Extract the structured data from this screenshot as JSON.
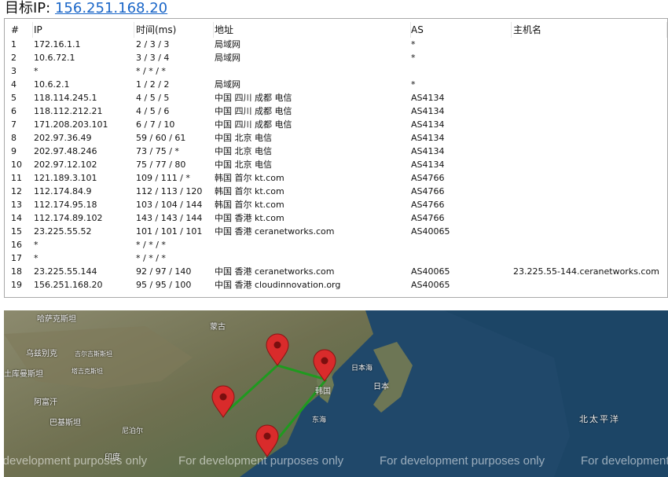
{
  "header": {
    "label": "目标IP:",
    "ip": "156.251.168.20"
  },
  "table": {
    "columns": [
      "#",
      "IP",
      "时间(ms)",
      "地址",
      "AS",
      "主机名"
    ],
    "rows": [
      {
        "n": "1",
        "ip": "172.16.1.1",
        "time": "2 / 3 / 3",
        "addr": "局域网",
        "as": "*",
        "host": ""
      },
      {
        "n": "2",
        "ip": "10.6.72.1",
        "time": "3 / 3 / 4",
        "addr": "局域网",
        "as": "*",
        "host": ""
      },
      {
        "n": "3",
        "ip": "*",
        "time": "* / * / *",
        "addr": "",
        "as": "",
        "host": ""
      },
      {
        "n": "4",
        "ip": "10.6.2.1",
        "time": "1 / 2 / 2",
        "addr": "局域网",
        "as": "*",
        "host": ""
      },
      {
        "n": "5",
        "ip": "118.114.245.1",
        "time": "4 / 5 / 5",
        "addr": "中国 四川 成都 电信",
        "as": "AS4134",
        "host": ""
      },
      {
        "n": "6",
        "ip": "118.112.212.21",
        "time": "4 / 5 / 6",
        "addr": "中国 四川 成都 电信",
        "as": "AS4134",
        "host": ""
      },
      {
        "n": "7",
        "ip": "171.208.203.101",
        "time": "6 / 7 / 10",
        "addr": "中国 四川 成都 电信",
        "as": "AS4134",
        "host": ""
      },
      {
        "n": "8",
        "ip": "202.97.36.49",
        "time": "59 / 60 / 61",
        "addr": "中国 北京 电信",
        "as": "AS4134",
        "host": ""
      },
      {
        "n": "9",
        "ip": "202.97.48.246",
        "time": "73 / 75 / *",
        "addr": "中国 北京 电信",
        "as": "AS4134",
        "host": ""
      },
      {
        "n": "10",
        "ip": "202.97.12.102",
        "time": "75 / 77 / 80",
        "addr": "中国 北京 电信",
        "as": "AS4134",
        "host": ""
      },
      {
        "n": "11",
        "ip": "121.189.3.101",
        "time": "109 / 111 / *",
        "addr": "韩国 首尔 kt.com",
        "as": "AS4766",
        "host": ""
      },
      {
        "n": "12",
        "ip": "112.174.84.9",
        "time": "112 / 113 / 120",
        "addr": "韩国 首尔 kt.com",
        "as": "AS4766",
        "host": ""
      },
      {
        "n": "13",
        "ip": "112.174.95.18",
        "time": "103 / 104 / 144",
        "addr": "韩国 首尔 kt.com",
        "as": "AS4766",
        "host": ""
      },
      {
        "n": "14",
        "ip": "112.174.89.102",
        "time": "143 / 143 / 144",
        "addr": "中国 香港 kt.com",
        "as": "AS4766",
        "host": ""
      },
      {
        "n": "15",
        "ip": "23.225.55.52",
        "time": "101 / 101 / 101",
        "addr": "中国 香港 ceranetworks.com",
        "as": "AS40065",
        "host": ""
      },
      {
        "n": "16",
        "ip": "*",
        "time": "* / * / *",
        "addr": "",
        "as": "",
        "host": ""
      },
      {
        "n": "17",
        "ip": "*",
        "time": "* / * / *",
        "addr": "",
        "as": "",
        "host": ""
      },
      {
        "n": "18",
        "ip": "23.225.55.144",
        "time": "92 / 97 / 140",
        "addr": "中国 香港 ceranetworks.com",
        "as": "AS40065",
        "host": "23.225.55-144.ceranetworks.com"
      },
      {
        "n": "19",
        "ip": "156.251.168.20",
        "time": "95 / 95 / 100",
        "addr": "中国 香港 cloudinnovation.org",
        "as": "AS40065",
        "host": ""
      }
    ]
  },
  "map": {
    "watermark": "For development purposes only",
    "labels": [
      "哈萨克斯坦",
      "蒙古",
      "乌兹别克",
      "吉尔吉斯斯坦",
      "塔吉克斯坦",
      "土库曼斯坦",
      "阿富汗",
      "巴基斯坦",
      "尼泊尔",
      "印度",
      "日本海",
      "日本",
      "韩国",
      "东海",
      "北太平洋"
    ],
    "colors": {
      "route": "#1f9a1f",
      "pin": "#d92b2b"
    }
  }
}
